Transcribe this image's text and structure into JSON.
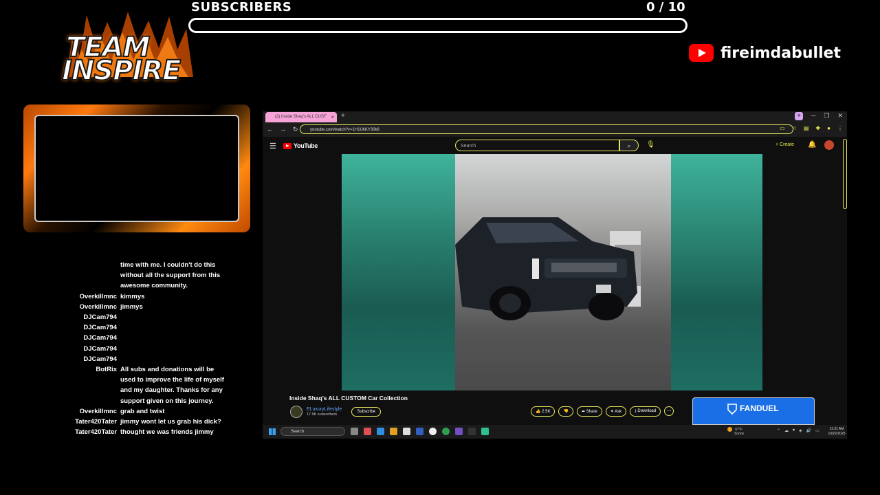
{
  "overlay": {
    "subscribers_label": "SUBSCRIBERS",
    "subscribers_count": "0  / 10",
    "subscribers_progress": 0,
    "logo_line1": "TEAM",
    "logo_line2": "INSPIRE",
    "channel_icon": "youtube-logo-icon",
    "channel_name": "fireimdabullet"
  },
  "chat": [
    {
      "user": "",
      "msg": "time with me. I couldn't do this without all the support from this awesome community."
    },
    {
      "user": "Overkillmnc",
      "msg": "kimmys"
    },
    {
      "user": "Overkillmnc",
      "msg": "jimmys"
    },
    {
      "user": "DJCam794",
      "msg": ""
    },
    {
      "user": "DJCam794",
      "msg": ""
    },
    {
      "user": "DJCam794",
      "msg": ""
    },
    {
      "user": "DJCam794",
      "msg": ""
    },
    {
      "user": "DJCam794",
      "msg": ""
    },
    {
      "user": "BotRix",
      "msg": "All subs and donations will be used to improve the life of myself and my daughter. Thanks for any support given on this journey."
    },
    {
      "user": "Overkillmnc",
      "msg": "grab and twist"
    },
    {
      "user": "Tater420Tater",
      "msg": "jimmy wont let us grab his dick?"
    },
    {
      "user": "Tater420Tater",
      "msg": "thought we was friends jimmy"
    }
  ],
  "browser": {
    "tab_title": "(2) Inside Shaq's ALL CUST",
    "tab_close": "×",
    "new_tab": "+",
    "url": "youtube.com/watch?v=1H1UkKY30k8",
    "youtube": {
      "brand": "YouTube",
      "search_placeholder": "Search",
      "create_label": "+ Create",
      "video_title": "Inside Shaq's ALL CUSTOM Car Collection",
      "channel_name": "ELuxuryLifestyle",
      "channel_subs": "17.9K subscribers",
      "subscribe_label": "Subscribe",
      "like_count": "2.5K",
      "share_label": "Share",
      "ask_label": "Ask",
      "download_label": "Download",
      "ad_brand": "FANDUEL"
    }
  },
  "taskbar": {
    "search_placeholder": "Search",
    "weather_temp": "67°F",
    "weather_desc": "Sunny",
    "time": "11:31 AM",
    "date": "10/22/2025"
  }
}
